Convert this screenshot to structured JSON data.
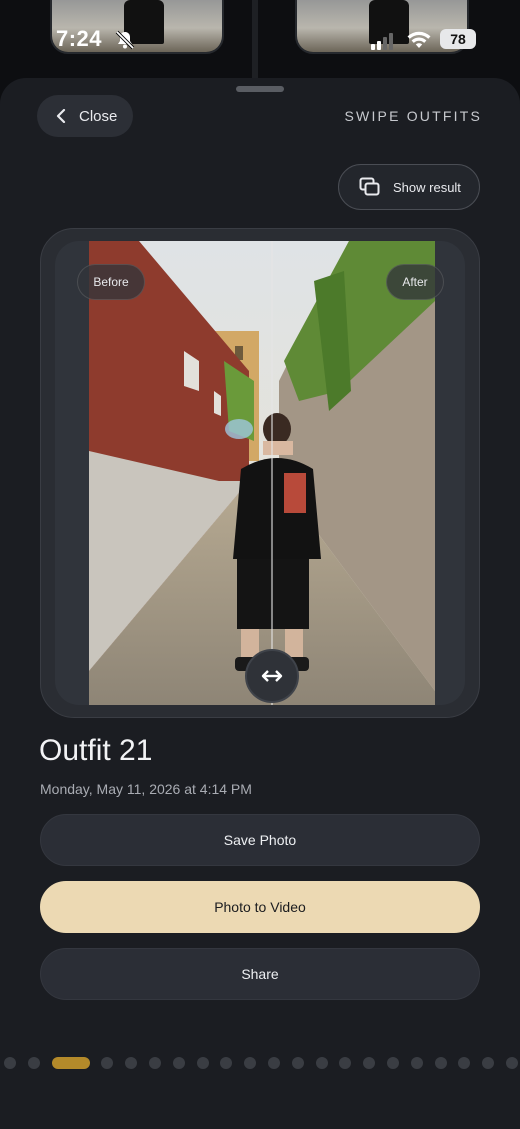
{
  "status_bar": {
    "time": "7:24",
    "battery": "78"
  },
  "sheet": {
    "close_label": "Close",
    "title": "SWIPE OUTFITS",
    "show_result_label": "Show result"
  },
  "compare": {
    "before_label": "Before",
    "after_label": "After",
    "slider_position": 0.53
  },
  "outfit": {
    "title": "Outfit 21",
    "date": "Monday, May 11, 2026 at 4:14 PM"
  },
  "actions": {
    "save_label": "Save Photo",
    "video_label": "Photo to Video",
    "share_label": "Share"
  },
  "pager": {
    "count": 21,
    "active_index": 2
  },
  "colors": {
    "accent": "#ecd9b3",
    "pager_active": "#b48a2a",
    "sheet_bg": "#1b1d22"
  },
  "icons": {
    "close": "chevron-left-icon",
    "show_result": "overlap-squares-icon",
    "slider_handle": "double-arrow-horizontal-icon",
    "silent": "bell-slash-icon",
    "wifi": "wifi-icon",
    "signal": "cellular-signal-icon"
  }
}
